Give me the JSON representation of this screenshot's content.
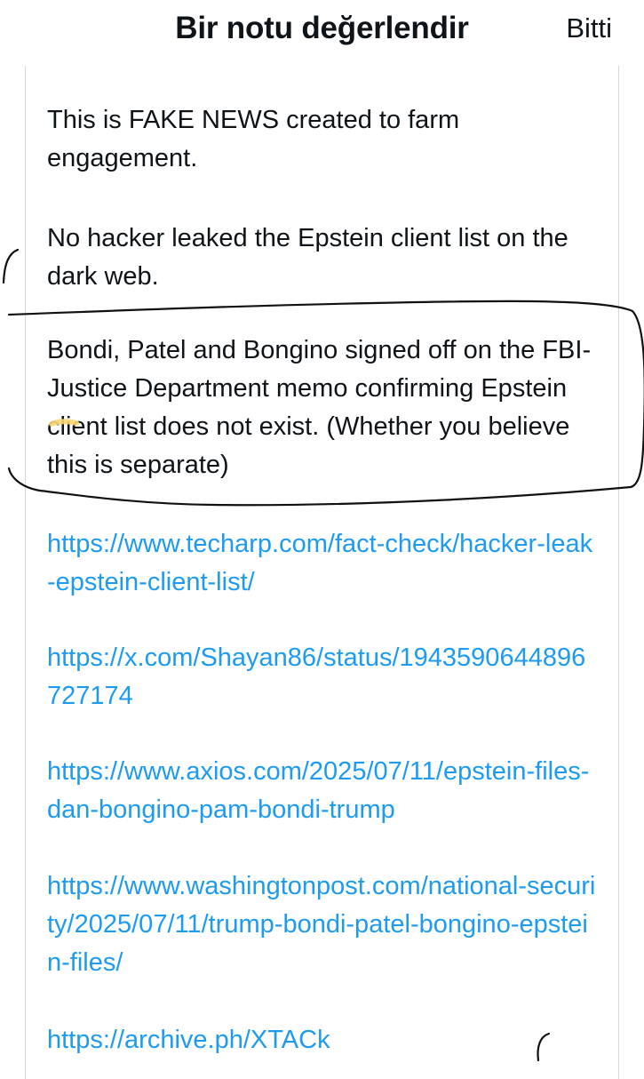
{
  "header": {
    "title": "Bir notu değerlendir",
    "done_label": "Bitti"
  },
  "note": {
    "paragraphs": [
      "This is FAKE NEWS created to farm engagement.",
      "No hacker leaked the Epstein client list on the dark web.",
      "Bondi, Patel and Bongino signed off on the FBI-Justice Department memo confirming Epstein client list does not exist. (Whether you believe this is separate)"
    ],
    "links": [
      "https://www.techarp.com/fact-check/hacker-leak-epstein-client-list/",
      "https://x.com/Shayan86/status/1943590644896727174",
      "https://www.axios.com/2025/07/11/epstein-files-dan-bongino-pam-bondi-trump",
      "https://www.washingtonpost.com/national-security/2025/07/11/trump-bondi-patel-bongino-epstein-files/",
      "https://archive.ph/XTACk"
    ]
  },
  "colors": {
    "link": "#1d9bf0",
    "text": "#0f1419",
    "border": "#cfd9de",
    "ink_annotation": "#111111",
    "highlight": "#f7d774"
  }
}
